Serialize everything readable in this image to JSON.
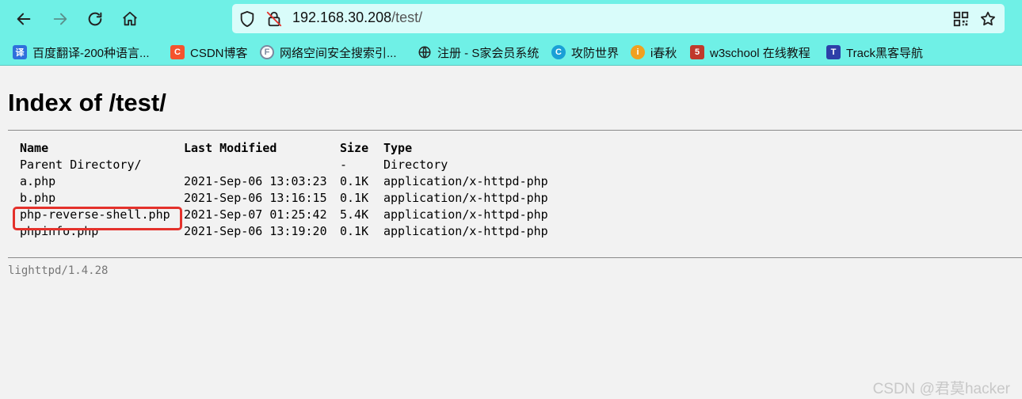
{
  "browser": {
    "url_host": "192.168.30.208",
    "url_path": "/test/",
    "accent_color": "#6ff0e6"
  },
  "bookmarks": [
    {
      "label": "百度翻译-200种语言...",
      "icon": "translate-icon",
      "icon_char": "译",
      "color": "#2f6fdc"
    },
    {
      "label": "CSDN博客",
      "icon": "csdn-icon",
      "icon_char": "C",
      "color": "#f4532d"
    },
    {
      "label": "网络空间安全搜索引...",
      "icon": "fofa-icon",
      "icon_char": "F",
      "color": "#7a8aa0"
    },
    {
      "label": "注册 - S家会员系统",
      "icon": "globe-icon",
      "icon_char": "",
      "color": "#222222"
    },
    {
      "label": "攻防世界",
      "icon": "adworld-icon",
      "icon_char": "C",
      "color": "#1a9fd6"
    },
    {
      "label": "i春秋",
      "icon": "ichunqiu-icon",
      "icon_char": "i",
      "color": "#f0a020"
    },
    {
      "label": "w3school 在线教程",
      "icon": "w3school-icon",
      "icon_char": "5",
      "color": "#c0392b"
    },
    {
      "label": "Track黑客导航",
      "icon": "track-icon",
      "icon_char": "T",
      "color": "#2d3fa8"
    }
  ],
  "page": {
    "title": "Index of /test/",
    "columns": {
      "name": "Name",
      "modified": "Last Modified",
      "size": "Size",
      "type": "Type"
    },
    "rows": [
      {
        "name": "Parent Directory/",
        "modified": "",
        "size": "-",
        "type": "Directory"
      },
      {
        "name": "a.php",
        "modified": "2021-Sep-06 13:03:23",
        "size": "0.1K",
        "type": "application/x-httpd-php"
      },
      {
        "name": "b.php",
        "modified": "2021-Sep-06 13:16:15",
        "size": "0.1K",
        "type": "application/x-httpd-php"
      },
      {
        "name": "php-reverse-shell.php",
        "modified": "2021-Sep-07 01:25:42",
        "size": "5.4K",
        "type": "application/x-httpd-php"
      },
      {
        "name": "phpinfo.php",
        "modified": "2021-Sep-06 13:19:20",
        "size": "0.1K",
        "type": "application/x-httpd-php"
      }
    ],
    "footer": "lighttpd/1.4.28"
  },
  "watermark": "CSDN @君莫hacker",
  "highlight_color": "#e4312b"
}
